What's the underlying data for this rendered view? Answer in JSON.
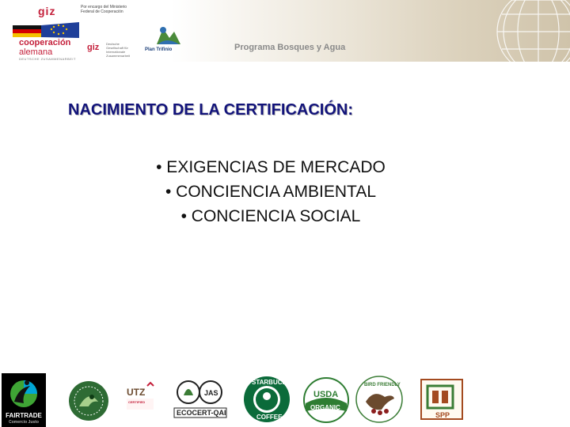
{
  "header": {
    "giz_top": "giz",
    "giz_top_text": "Por encargo del Ministerio Federal de Cooperación",
    "cooperacion": "cooperación",
    "alemana": "alemana",
    "coop_sub": "DEUTSCHE ZUSAMMENARBEIT",
    "giz_mid": "giz",
    "giz_mid_text": "Deutsche Gesellschaft für Internationale Zusammenarbeit",
    "plan_trifinio": "Plan Trifinio",
    "program_title": "Programa Bosques y Agua"
  },
  "content": {
    "heading": "NACIMIENTO DE LA CERTIFICACIÓN:",
    "bullets": [
      "• EXIGENCIAS DE MERCADO",
      "• CONCIENCIA AMBIENTAL",
      "• CONCIENCIA SOCIAL"
    ]
  },
  "logos": {
    "fairtrade": "FAIRTRADE",
    "fairtrade_sub": "Comercio Justo",
    "utz": "UTZ",
    "utz_sub": "CERTIFIED",
    "jas": "JAS",
    "ecocert": "ECOCERT-QAI",
    "starbucks": "STARBUCKS",
    "coffee": "COFFEE",
    "usda": "USDA",
    "organic": "ORGANIC",
    "bird_friendly": "BIRD FRIENDLY",
    "spp": "SPP"
  },
  "colors": {
    "heading": "#12137a",
    "giz_red": "#c4203b",
    "rainforest_green": "#2e6b34",
    "usda_green": "#2e7d32",
    "spp_brown": "#a34a1f"
  }
}
